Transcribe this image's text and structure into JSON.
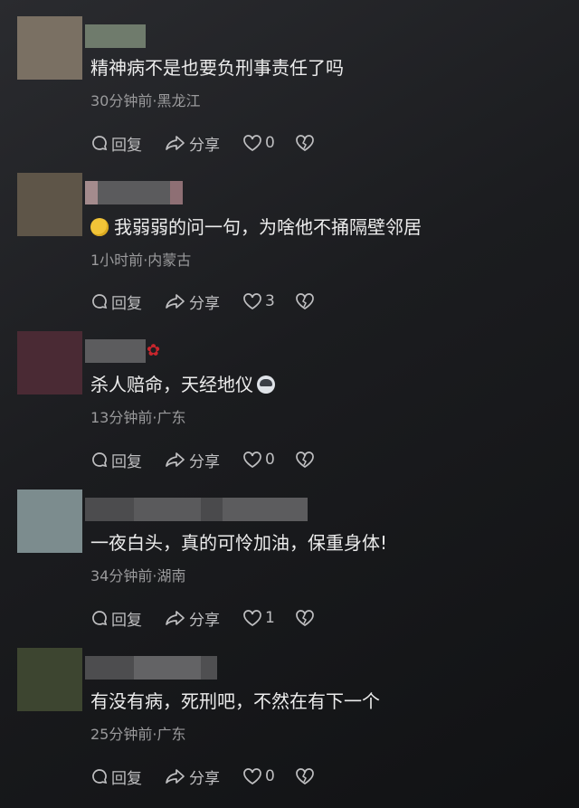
{
  "comments": [
    {
      "avatar_color": "#7a7063",
      "name_colors": [
        "#6f7b6c"
      ],
      "text": "精神病不是也要负刑事责任了吗",
      "time": "30分钟前",
      "location": "黑龙江",
      "reply_label": "回复",
      "share_label": "分享",
      "likes": "0"
    },
    {
      "avatar_color": "#5e5548",
      "name_colors": [
        "#a48b8d",
        "#5b5b5d",
        "#8e6f74"
      ],
      "emoji": "face-emoji",
      "text": "我弱弱的问一句，为啥他不捅隔壁邻居",
      "time": "1小时前",
      "location": "内蒙古",
      "reply_label": "回复",
      "share_label": "分享",
      "likes": "3"
    },
    {
      "avatar_color": "#4a2a34",
      "name_colors": [
        "#5c5c5e"
      ],
      "rose": "rose-icon",
      "text": "杀人赔命，天经地仪",
      "trailing_emoji": "cat-emoji",
      "time": "13分钟前",
      "location": "广东",
      "reply_label": "回复",
      "share_label": "分享",
      "likes": "0"
    },
    {
      "avatar_color": "#7c8c8e",
      "name_colors": [
        "#4c4c4e",
        "#5a5a5c",
        "#4a4a4c",
        "#5c5c5e"
      ],
      "text": "一夜白头，真的可怜加油，保重身体!",
      "time": "34分钟前",
      "location": "湖南",
      "reply_label": "回复",
      "share_label": "分享",
      "likes": "1"
    },
    {
      "avatar_color": "#3d4530",
      "name_colors": [
        "#4d4d4f",
        "#636365",
        "#4f4f51"
      ],
      "text": "有没有病，死刑吧，不然在有下一个",
      "time": "25分钟前",
      "location": "广东",
      "reply_label": "回复",
      "share_label": "分享",
      "likes": "0"
    }
  ]
}
